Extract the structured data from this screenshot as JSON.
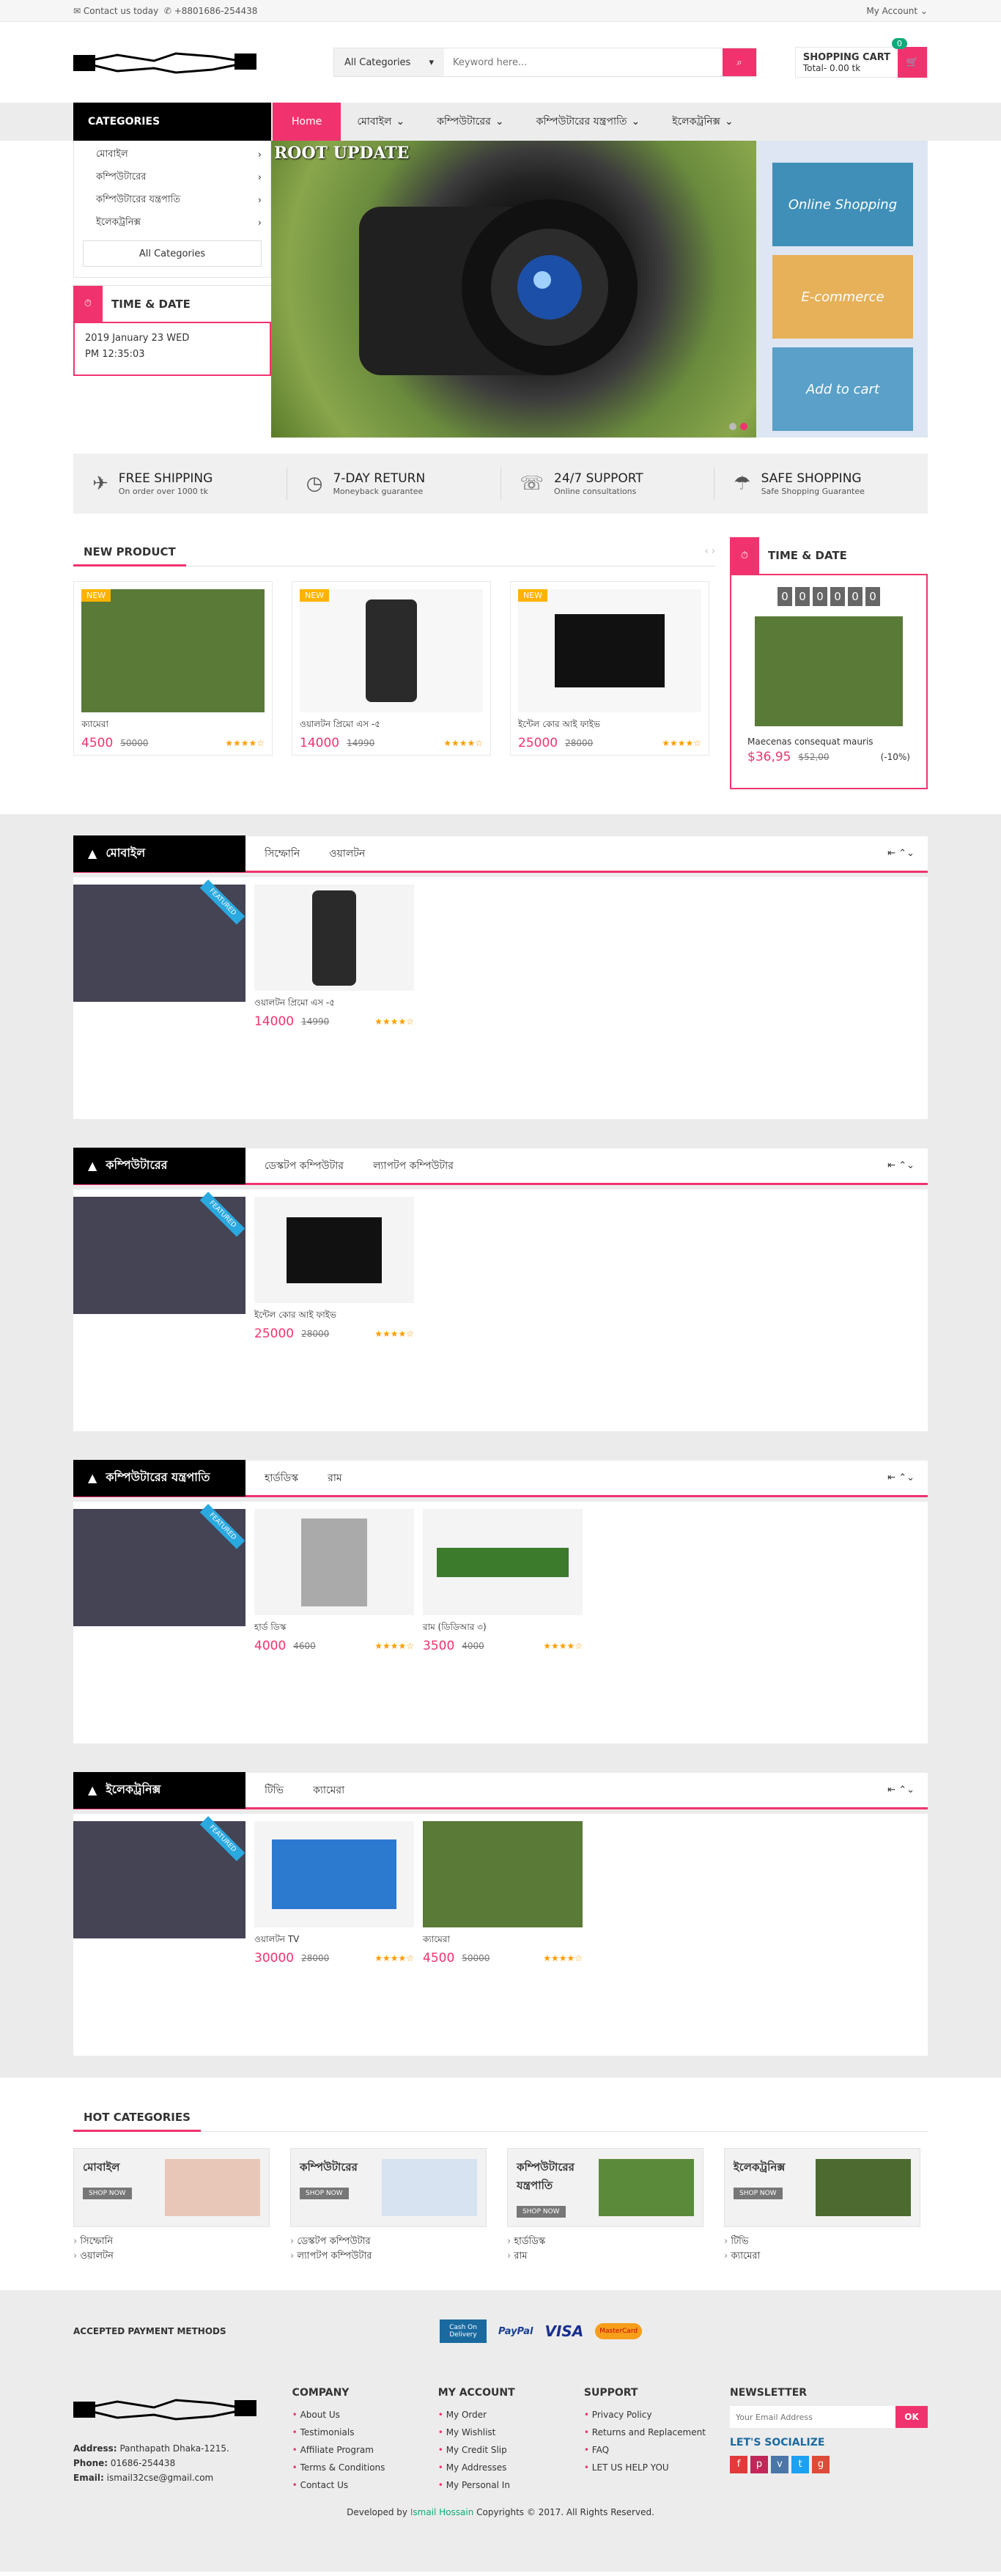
{
  "topbar": {
    "contact": "Contact us today",
    "phone": "+8801686-254438",
    "account": "My Account"
  },
  "header": {
    "category_select": "All Categories",
    "search_placeholder": "Keyword here...",
    "cart_title": "SHOPPING CART",
    "cart_total": "Total- 0.00 tk",
    "cart_count": "0"
  },
  "nav": {
    "categories": "CATEGORIES",
    "home": "Home",
    "items": [
      "মোবাইল",
      "কম্পিউটারের",
      "কম্পিউটারের যন্ত্রপাতি",
      "ইলেকট্রনিক্স"
    ]
  },
  "sidebar": {
    "items": [
      "মোবাইল",
      "কম্পিউটারের",
      "কম্পিউটারের যন্ত্রপাতি",
      "ইলেকট্রনিক্স"
    ],
    "all": "All Categories",
    "time_title": "TIME & DATE",
    "date": "2019 January 23 WED",
    "time": "PM 12:35:03"
  },
  "banner": {
    "label": "ROOT UPDATE",
    "ads": [
      "Online Shopping",
      "E-commerce",
      "Add to cart"
    ]
  },
  "features": [
    {
      "t": "FREE SHIPPING",
      "s": "On order over 1000 tk"
    },
    {
      "t": "7-DAY RETURN",
      "s": "Moneyback guarantee"
    },
    {
      "t": "24/7 SUPPORT",
      "s": "Online consultations"
    },
    {
      "t": "SAFE SHOPPING",
      "s": "Safe Shopping Guarantee"
    }
  ],
  "new_product": {
    "title": "NEW PRODUCT",
    "items": [
      {
        "tag": "NEW",
        "name": "ক্যামেরা",
        "price": "4500",
        "old": "50000"
      },
      {
        "tag": "NEW",
        "name": "ওয়ালটন প্রিমো এস -৫",
        "price": "14000",
        "old": "14990"
      },
      {
        "tag": "NEW",
        "name": "ইন্টেল কোর আই ফাইভ",
        "price": "25000",
        "old": "28000"
      }
    ]
  },
  "deal": {
    "title": "TIME & DATE",
    "timer": [
      "0",
      "0",
      "0",
      "0",
      "0",
      "0"
    ],
    "name": "Maecenas consequat mauris",
    "price": "$36,95",
    "old": "$52,00",
    "off": "(-10%)"
  },
  "sections": [
    {
      "title": "মোবাইল",
      "tabs": [
        "সিম্ফোনি",
        "ওয়ালটন"
      ],
      "products": [
        {
          "name": "ওয়ালটন প্রিমো এস -৫",
          "price": "14000",
          "old": "14990"
        }
      ]
    },
    {
      "title": "কম্পিউটারের",
      "tabs": [
        "ডেস্কটপ কম্পিউটার",
        "ল্যাপটপ কম্পিউটার"
      ],
      "products": [
        {
          "name": "ইন্টেল কোর আই ফাইভ",
          "price": "25000",
          "old": "28000"
        }
      ]
    },
    {
      "title": "কম্পিউটারের যন্ত্রপাতি",
      "tabs": [
        "হার্ডডিস্ক",
        "রাম"
      ],
      "products": [
        {
          "name": "হার্ড ডিস্ক",
          "price": "4000",
          "old": "4600"
        },
        {
          "name": "রাম (ডিডিআর ৩)",
          "price": "3500",
          "old": "4000"
        }
      ]
    },
    {
      "title": "ইলেকট্রনিক্স",
      "tabs": [
        "টিভি",
        "ক্যামেরা"
      ],
      "products": [
        {
          "name": "ওয়ালটন TV",
          "price": "30000",
          "old": "28000"
        },
        {
          "name": "ক্যামেরা",
          "price": "4500",
          "old": "50000"
        }
      ]
    }
  ],
  "featured": "FEATURED",
  "hot": {
    "title": "HOT CATEGORIES",
    "shop": "SHOP NOW",
    "cats": [
      {
        "t": "মোবাইল",
        "l": [
          "সিম্ফোনি",
          "ওয়ালটন"
        ]
      },
      {
        "t": "কম্পিউটারের",
        "l": [
          "ডেস্কটপ কম্পিউটার",
          "ল্যাপটপ কম্পিউটার"
        ]
      },
      {
        "t": "কম্পিউটারের যন্ত্রপাতি",
        "l": [
          "হার্ডডিস্ক",
          "রাম"
        ]
      },
      {
        "t": "ইলেকট্রনিক্স",
        "l": [
          "টিভি",
          "ক্যামেরা"
        ]
      }
    ]
  },
  "payment": {
    "label": "ACCEPTED PAYMENT METHODS",
    "methods": [
      "Cash On Delivery",
      "PayPal",
      "VISA",
      "MasterCard"
    ]
  },
  "footer": {
    "address": "Panthapath Dhaka-1215.",
    "phone": "01686-254438",
    "email": "ismail32cse@gmail.com",
    "company": [
      "About Us",
      "Testimonials",
      "Affiliate Program",
      "Terms & Conditions",
      "Contact Us"
    ],
    "account": [
      "My Order",
      "My Wishlist",
      "My Credit Slip",
      "My Addresses",
      "My Personal In"
    ],
    "support": [
      "Privacy Policy",
      "Returns and Replacement",
      "FAQ",
      "LET US HELP YOU"
    ],
    "newsletter_ph": "Your Email Address",
    "ok": "OK",
    "social": "LET'S SOCIALIZE",
    "copy": "Developed by",
    "author": "Ismail Hossain",
    "rights": "Copyrights © 2017. All Rights Reserved."
  }
}
